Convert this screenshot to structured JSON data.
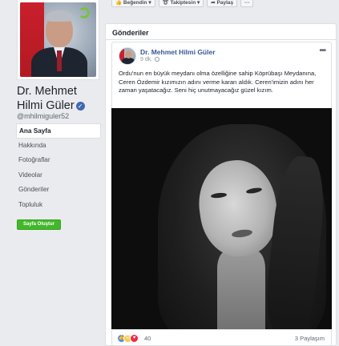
{
  "sidebar": {
    "page_name": "Dr. Mehmet Hilmi Güler",
    "handle": "@mhilmiguler52",
    "nav": [
      {
        "label": "Ana Sayfa"
      },
      {
        "label": "Hakkında"
      },
      {
        "label": "Fotoğraflar"
      },
      {
        "label": "Videolar"
      },
      {
        "label": "Gönderiler"
      },
      {
        "label": "Topluluk"
      }
    ],
    "create_page_label": "Sayfa Oluştur"
  },
  "header_actions": {
    "like_label": "Beğendin",
    "follow_label": "Takiptesin",
    "share_label": "Paylaş",
    "more_label": "···"
  },
  "main": {
    "section_title": "Gönderiler"
  },
  "post": {
    "author": "Dr. Mehmet Hilmi Güler",
    "time": "9 dk.",
    "text": "Ordu'nun en büyük meydanı olma özelliğine sahip Köprübaşı Meydanına, Ceren Özdemir kızımızın adını verme kararı aldık. Ceren'imizin adını her zaman yaşatacağız. Seni hiç unutmayacağız güzel kızım.",
    "reaction_count": "40",
    "share_count": "3 Paylaşım"
  },
  "colors": {
    "accent": "#4267b2",
    "link": "#385898",
    "create_button": "#42b72a",
    "background": "#e9ebee"
  }
}
